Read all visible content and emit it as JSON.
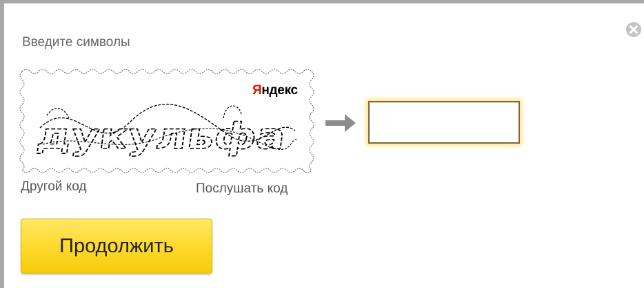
{
  "dialog": {
    "prompt": "Введите символы",
    "captcha": {
      "text": "дукульфа",
      "brand_first_letter": "Я",
      "brand_rest": "ндекс"
    },
    "links": {
      "other_code": "Другой код",
      "listen_code": "Послушать код"
    },
    "input": {
      "value": "",
      "placeholder": ""
    },
    "continue_label": "Продолжить",
    "icons": {
      "close": "close-icon",
      "arrow": "arrow-right-icon"
    },
    "colors": {
      "button": "#ffdb33",
      "brand_red": "#e61400",
      "input_glow": "#ffcd28"
    }
  }
}
